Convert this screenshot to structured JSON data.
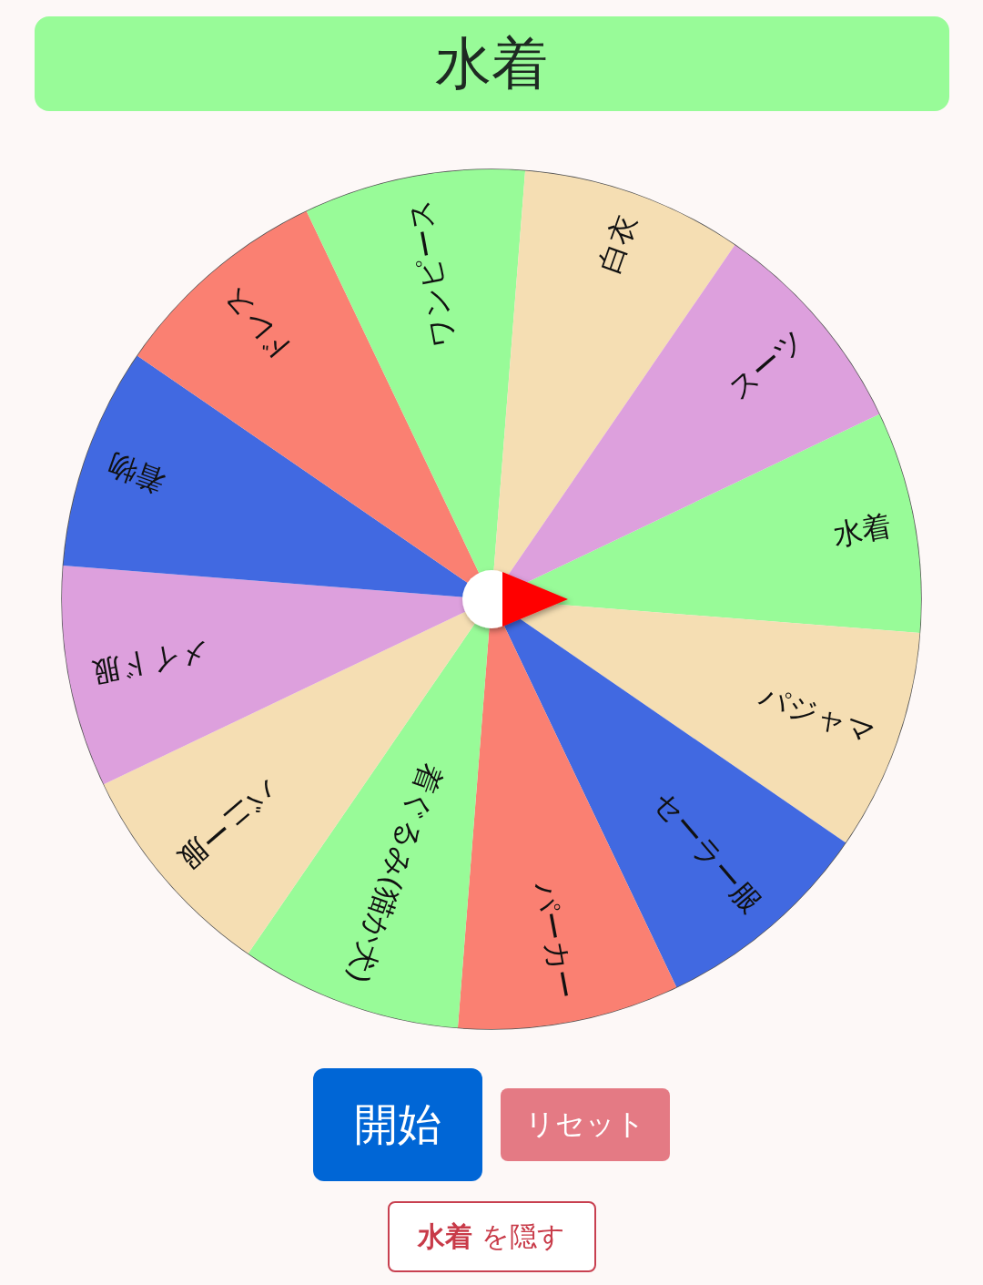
{
  "result": {
    "title": "水着"
  },
  "wheel": {
    "segments": [
      {
        "label": "水着",
        "color": "#98fb98"
      },
      {
        "label": "パジャマ",
        "color": "#f5deb3"
      },
      {
        "label": "セーラー服",
        "color": "#4169e1"
      },
      {
        "label": "パーカー",
        "color": "#fa8072"
      },
      {
        "label": "着ぐるみ(猫か犬)",
        "color": "#98fb98"
      },
      {
        "label": "バニー服",
        "color": "#f5deb3"
      },
      {
        "label": "メイド服",
        "color": "#dda0dd"
      },
      {
        "label": "着物",
        "color": "#4169e1"
      },
      {
        "label": "ドレス",
        "color": "#fa8072"
      },
      {
        "label": "ワンピース",
        "color": "#98fb98"
      },
      {
        "label": "白衣",
        "color": "#f5deb3"
      },
      {
        "label": "スーツ",
        "color": "#dda0dd"
      }
    ]
  },
  "buttons": {
    "start": "開始",
    "reset": "リセット",
    "hide": "**水着** を隠す"
  }
}
